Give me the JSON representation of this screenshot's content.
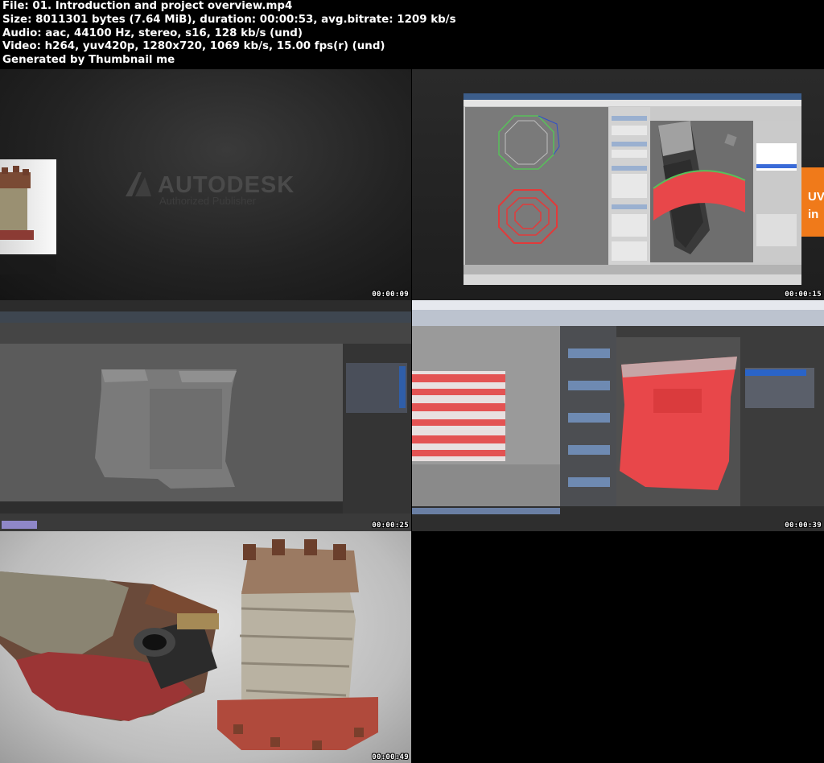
{
  "header": {
    "line1": "File: 01. Introduction and project overview.mp4",
    "line2": "Size: 8011301 bytes (7.64 MiB), duration: 00:00:53, avg.bitrate: 1209 kb/s",
    "line3": "Audio: aac, 44100 Hz, stereo, s16, 128 kb/s (und)",
    "line4": "Video: h264, yuv420p, 1280x720, 1069 kb/s, 15.00 fps(r) (und)",
    "line5": "Generated by Thumbnail me"
  },
  "frames": [
    {
      "timestamp": "00:00:09",
      "brand": "AUTODESK",
      "brand_sub": "Authorized Publisher"
    },
    {
      "timestamp": "00:00:15",
      "promo_text": "UV\nin"
    },
    {
      "timestamp": "00:00:25"
    },
    {
      "timestamp": "00:00:39"
    },
    {
      "timestamp": "00:00:49"
    }
  ],
  "colors": {
    "background": "#000000",
    "header_text": "#ffffff",
    "selection_red": "#e8474a",
    "promo_orange": "#f07a1a"
  }
}
